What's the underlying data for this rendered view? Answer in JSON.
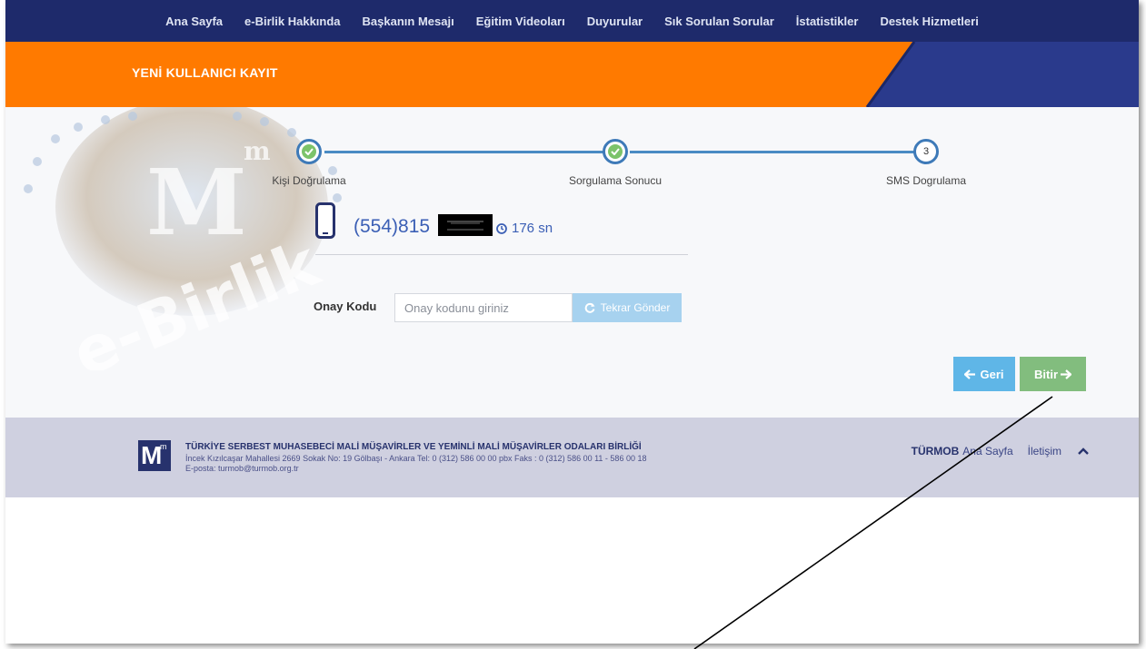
{
  "nav": {
    "items": [
      {
        "label": "Ana Sayfa"
      },
      {
        "label": "e-Birlik Hakkında"
      },
      {
        "label": "Başkanın Mesajı"
      },
      {
        "label": "Eğitim Videoları"
      },
      {
        "label": "Duyurular"
      },
      {
        "label": "Sık Sorulan Sorular"
      },
      {
        "label": "İstatistikler"
      },
      {
        "label": "Destek Hizmetleri"
      }
    ]
  },
  "banner": {
    "title": "YENİ KULLANICI KAYIT"
  },
  "watermark": {
    "logo_text": "e-Birlik"
  },
  "steps": [
    {
      "label": "Kişi Doğrulama",
      "status": "done"
    },
    {
      "label": "Sorgulama Sonucu",
      "status": "done"
    },
    {
      "label": "SMS Dogrulama",
      "status": "current",
      "number": "3"
    }
  ],
  "phone": {
    "number": "(554)815",
    "timer": "176 sn"
  },
  "form": {
    "label": "Onay Kodu",
    "placeholder": "Onay kodunu giriniz",
    "resend_label": "Tekrar Gönder"
  },
  "buttons": {
    "back": "Geri",
    "finish": "Bitir"
  },
  "footer": {
    "logo_letter": "M",
    "logo_sup": "m",
    "org_name": "TÜRKİYE SERBEST MUHASEBECİ MALİ MÜŞAVİRLER VE YEMİNLİ MALİ MÜŞAVİRLER ODALARI BİRLİĞİ",
    "address": "İncek Kızılcaşar Mahallesi 2669 Sokak No: 19 Gölbaşı - Ankara Tel: 0 (312) 586 00 00 pbx Faks : 0 (312) 586 00 11 - 586 00 18",
    "email": "E-posta: turmob@turmob.org.tr",
    "link_brand": "TÜRMOB",
    "link_home": "Ana Sayfa",
    "link_contact": "İletişim"
  },
  "colors": {
    "nav_bg": "#1e2a6b",
    "banner_orange": "#ff7a00",
    "banner_navy": "#2a3a8c",
    "step_blue": "#3e7ab8",
    "check_green": "#7cc36a",
    "phone_blue": "#3b5fb5",
    "back_button": "#5fb6e7",
    "finish_button": "#82bd7e",
    "footer_bg": "#cfd0e0"
  },
  "icons": [
    "check-icon",
    "mobile-phone-icon",
    "clock-icon",
    "refresh-icon",
    "arrow-left-icon",
    "arrow-right-icon",
    "chevron-up-icon"
  ]
}
